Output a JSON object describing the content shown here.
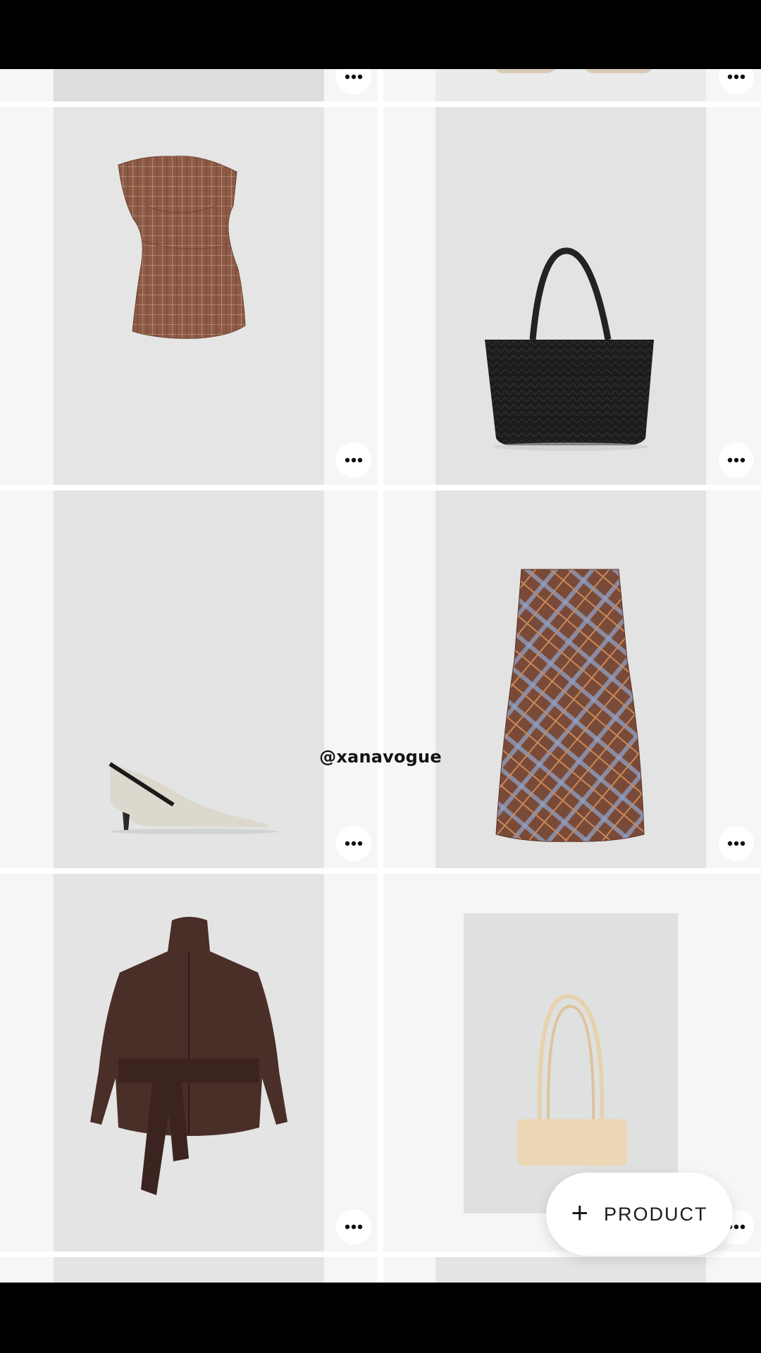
{
  "watermark": "@xanavogue",
  "fab": {
    "icon": "+",
    "label": "PRODUCT"
  },
  "items": [
    {
      "name": "Plaid asymmetric sleeveless top"
    },
    {
      "name": "Black woven leather tote bag"
    },
    {
      "name": "Cream kitten heel pumps"
    },
    {
      "name": "Brown plaid midi skirt"
    },
    {
      "name": "Dark brown belted leather jacket"
    },
    {
      "name": "Beige shoulder bag"
    }
  ],
  "colors": {
    "status_bar": "#000000",
    "photo_bg": "#e3e4e4",
    "cell_bg": "#f6f6f6"
  }
}
